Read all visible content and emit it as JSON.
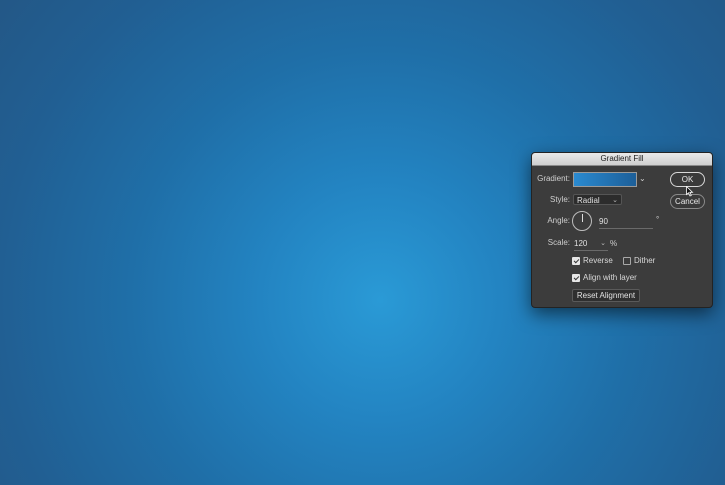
{
  "dialog": {
    "title": "Gradient Fill",
    "gradient_label": "Gradient:",
    "gradient_colors": [
      "#2a8ad0",
      "#1d5f99"
    ],
    "style_label": "Style:",
    "style_value": "Radial",
    "angle_label": "Angle:",
    "angle_value": "90",
    "angle_unit": "°",
    "scale_label": "Scale:",
    "scale_value": "120",
    "scale_unit": "%",
    "reverse_label": "Reverse",
    "reverse_checked": true,
    "dither_label": "Dither",
    "dither_checked": false,
    "align_label": "Align with layer",
    "align_checked": true,
    "reset_label": "Reset Alignment",
    "ok_label": "OK",
    "cancel_label": "Cancel"
  },
  "icons": {
    "gradient_dropdown": "chevron-down-icon",
    "style_dropdown": "chevron-down-icon",
    "scale_dropdown": "chevron-down-icon",
    "angle_dial": "angle-dial-icon",
    "cursor": "mouse-pointer-icon"
  },
  "colors": {
    "canvas_center": "#2a9ad6",
    "canvas_edge": "#245582",
    "dialog_bg": "#3c3c3c"
  }
}
